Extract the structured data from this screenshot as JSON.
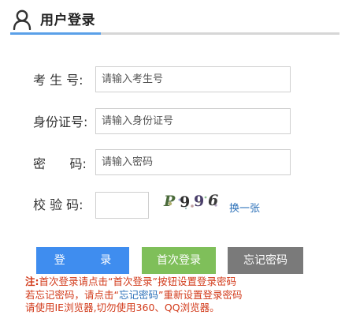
{
  "header": {
    "title": "用户登录",
    "accent_color": "#5aa0e8"
  },
  "form": {
    "exam_id": {
      "label": "考 生 号:",
      "placeholder": "请输入考生号",
      "value": ""
    },
    "id_card": {
      "label": "身份证号:",
      "placeholder": "请输入身份证号",
      "value": ""
    },
    "password": {
      "label": "密      码:",
      "placeholder": "请输入密码",
      "value": ""
    },
    "captcha": {
      "label": "校 验 码:",
      "value": "",
      "image_chars": [
        "P",
        "9",
        "9",
        "6"
      ],
      "refresh_label": "换一张"
    }
  },
  "buttons": {
    "login": "登          录",
    "first_login": "首次登录",
    "forgot_password": "忘记密码"
  },
  "notes": {
    "prefix": "注:",
    "line1": "首次登录请点击“首次登录”按钮设置登录密码",
    "line2_a": "若忘记密码，请点击“",
    "line2_link": "忘记密码",
    "line2_b": "”重新设置登录密码",
    "line3": "请使用IE浏览器,切勿使用360、QQ浏览器。"
  },
  "colors": {
    "login_button": "#3f8def",
    "first_login_button": "#7fbf5a",
    "forgot_button": "#7a7a7a",
    "note_text": "#d23a1a",
    "link": "#2a6fb8"
  }
}
